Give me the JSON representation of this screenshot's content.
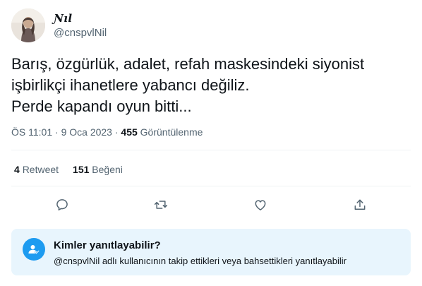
{
  "author": {
    "display_name": "Ɲıl",
    "handle": "@cnspvlNil"
  },
  "tweet": {
    "lines": [
      "Barış, özgürlük, adalet, refah maskesindeki siyonist",
      "işbirlikçi ihanetlere yabancı değiliz.",
      "Perde kapandı oyun bitti..."
    ]
  },
  "meta": {
    "time": "ÖS 11:01",
    "separator": "·",
    "date": "9 Oca 2023",
    "views_count": "455",
    "views_label": "Görüntülenme"
  },
  "stats": {
    "retweets_count": "4",
    "retweets_label": "Retweet",
    "likes_count": "151",
    "likes_label": "Beğeni"
  },
  "actions": {
    "icons": [
      "reply-icon",
      "retweet-icon",
      "like-icon",
      "share-icon"
    ]
  },
  "reply_restriction": {
    "title": "Kimler yanıtlayabilir?",
    "subtitle": "@cnspvlNil adlı kullanıcının takip ettikleri veya bahsettikleri yanıtlayabilir",
    "icon": "person-check-icon"
  },
  "colors": {
    "accent": "#1d9bf0",
    "secondary_text": "#536471",
    "reply_box_bg": "#e8f5fd",
    "divider": "#eff3f4"
  }
}
